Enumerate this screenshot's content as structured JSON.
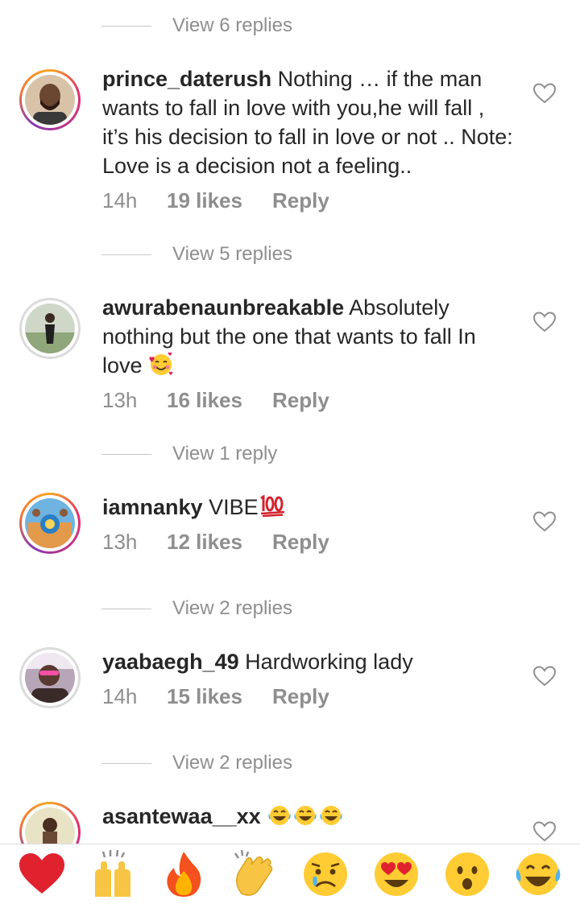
{
  "threads": [
    {
      "replies": "View 6 replies"
    },
    {
      "replies": "View 5 replies"
    },
    {
      "replies": "View 1 reply"
    },
    {
      "replies": "View 2 replies"
    },
    {
      "replies": "View 2 replies"
    }
  ],
  "comments": [
    {
      "username": "prince_daterush",
      "text": "Nothing … if the man wants to fall in love with you,he will fall , it’s his decision to fall in love or not .. Note: Love is a decision not a feeling..",
      "time": "14h",
      "likes": "19 likes",
      "reply": "Reply"
    },
    {
      "username": "awurabenaunbreakable",
      "text": "Absolutely nothing but the one that wants to fall In love",
      "emoji": "smiling-face-with-hearts",
      "time": "13h",
      "likes": "16 likes",
      "reply": "Reply"
    },
    {
      "username": "iamnanky",
      "text": "VIBE",
      "emoji": "hundred-points",
      "time": "13h",
      "likes": "12 likes",
      "reply": "Reply"
    },
    {
      "username": "yaabaegh_49",
      "text": "Hardworking lady",
      "time": "14h",
      "likes": "15 likes",
      "reply": "Reply"
    },
    {
      "username": "asantewaa__xx",
      "text": "",
      "emoji": "tears-of-joy x3"
    }
  ],
  "emoji_bar": [
    "red-heart",
    "raising-hands",
    "fire",
    "clapping-hands",
    "sad-face",
    "heart-eyes",
    "surprised-face",
    "tears-of-joy"
  ],
  "colors": {
    "text": "#262626",
    "secondary": "#8e8e8e",
    "divider": "#dbdbdb"
  }
}
